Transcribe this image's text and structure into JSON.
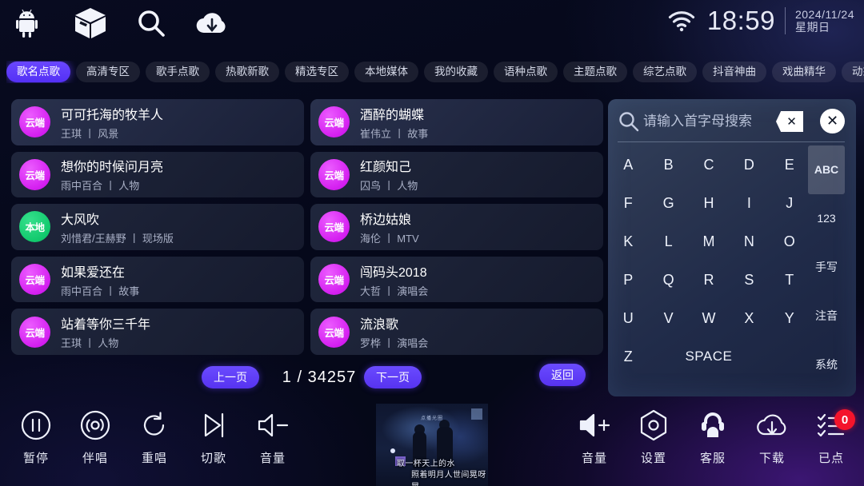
{
  "topbar": {
    "icons": [
      {
        "name": "android-icon",
        "label": "Android"
      },
      {
        "name": "box-icon",
        "label": "Apps"
      },
      {
        "name": "search-icon",
        "label": "Search"
      },
      {
        "name": "cloud-download-icon",
        "label": "Download"
      }
    ],
    "wifi_icon": "wifi-icon",
    "time": "18:59",
    "date": "2024/11/24",
    "weekday": "星期日"
  },
  "tabs": [
    {
      "label": "歌名点歌",
      "active": true
    },
    {
      "label": "高清专区",
      "active": false
    },
    {
      "label": "歌手点歌",
      "active": false
    },
    {
      "label": "热歌新歌",
      "active": false
    },
    {
      "label": "精选专区",
      "active": false
    },
    {
      "label": "本地媒体",
      "active": false
    },
    {
      "label": "我的收藏",
      "active": false
    },
    {
      "label": "语种点歌",
      "active": false
    },
    {
      "label": "主题点歌",
      "active": false
    },
    {
      "label": "综艺点歌",
      "active": false
    },
    {
      "label": "抖音神曲",
      "active": false
    },
    {
      "label": "戏曲精华",
      "active": false
    },
    {
      "label": "动态乐谱",
      "active": false
    }
  ],
  "songs": {
    "left": [
      {
        "badge": "云端",
        "badge_type": "cloud",
        "title": "可可托海的牧羊人",
        "meta": "王琪 丨 风景",
        "highlight": true
      },
      {
        "badge": "云端",
        "badge_type": "cloud",
        "title": "想你的时候问月亮",
        "meta": "雨中百合 丨 人物",
        "highlight": false
      },
      {
        "badge": "本地",
        "badge_type": "local",
        "title": "大风吹",
        "meta": "刘惜君/王赫野 丨 现场版",
        "highlight": false
      },
      {
        "badge": "云端",
        "badge_type": "cloud",
        "title": "如果爱还在",
        "meta": "雨中百合 丨 故事",
        "highlight": false
      },
      {
        "badge": "云端",
        "badge_type": "cloud",
        "title": "站着等你三千年",
        "meta": "王琪 丨 人物",
        "highlight": false
      }
    ],
    "right": [
      {
        "badge": "云端",
        "badge_type": "cloud",
        "title": "酒醉的蝴蝶",
        "meta": "崔伟立 丨 故事",
        "highlight": true
      },
      {
        "badge": "云端",
        "badge_type": "cloud",
        "title": "红颜知己",
        "meta": "囚鸟 丨 人物",
        "highlight": false
      },
      {
        "badge": "云端",
        "badge_type": "cloud",
        "title": "桥边姑娘",
        "meta": "海伦 丨 MTV",
        "highlight": false
      },
      {
        "badge": "云端",
        "badge_type": "cloud",
        "title": "闯码头2018",
        "meta": "大哲 丨 演唱会",
        "highlight": false
      },
      {
        "badge": "云端",
        "badge_type": "cloud",
        "title": "流浪歌",
        "meta": "罗桦 丨 演唱会",
        "highlight": false
      }
    ]
  },
  "pager": {
    "prev_label": "上一页",
    "next_label": "下一页",
    "back_label": "返回",
    "page_info": "1 / 34257",
    "current_page": 1,
    "total_pages": 34257
  },
  "keyboard": {
    "search_placeholder": "请输入首字母搜索",
    "search_value": "",
    "backspace_icon": "backspace-icon",
    "clear_icon": "close-circle-icon",
    "search_icon": "search-icon",
    "rows": [
      [
        "A",
        "B",
        "C",
        "D",
        "E"
      ],
      [
        "F",
        "G",
        "H",
        "I",
        "J"
      ],
      [
        "K",
        "L",
        "M",
        "N",
        "O"
      ],
      [
        "P",
        "Q",
        "R",
        "S",
        "T"
      ],
      [
        "U",
        "V",
        "W",
        "X",
        "Y"
      ]
    ],
    "last_row": {
      "z": "Z",
      "space": "SPACE"
    },
    "modes": [
      {
        "label": "ABC",
        "selected": true
      },
      {
        "label": "123",
        "selected": false
      },
      {
        "label": "手写",
        "selected": false
      },
      {
        "label": "注音",
        "selected": false
      },
      {
        "label": "系统",
        "selected": false
      }
    ]
  },
  "bottom": {
    "left_buttons": [
      {
        "label": "暂停",
        "icon": "pause-circle-icon"
      },
      {
        "label": "伴唱",
        "icon": "disc-icon"
      },
      {
        "label": "重唱",
        "icon": "restart-icon"
      },
      {
        "label": "切歌",
        "icon": "skip-next-icon"
      },
      {
        "label": "音量",
        "icon": "volume-down-icon"
      }
    ],
    "right_buttons": [
      {
        "label": "音量",
        "icon": "volume-up-icon",
        "badge": null
      },
      {
        "label": "设置",
        "icon": "gear-hex-icon",
        "badge": null
      },
      {
        "label": "客服",
        "icon": "headset-support-icon",
        "badge": null
      },
      {
        "label": "下载",
        "icon": "cloud-download-icon",
        "badge": null
      },
      {
        "label": "已点",
        "icon": "playlist-checked-icon",
        "badge": "0"
      }
    ]
  },
  "video": {
    "channel_title": "点播光圈",
    "lyric_line1": "取一杯天上的水",
    "lyric_line2": "照着明月人世间晃呀晃"
  },
  "colors": {
    "accent": "#5733f0",
    "cloud_badge": "#d41ff0",
    "local_badge": "#12c96d",
    "badge_red": "#f4142b",
    "background": "#05081a"
  }
}
